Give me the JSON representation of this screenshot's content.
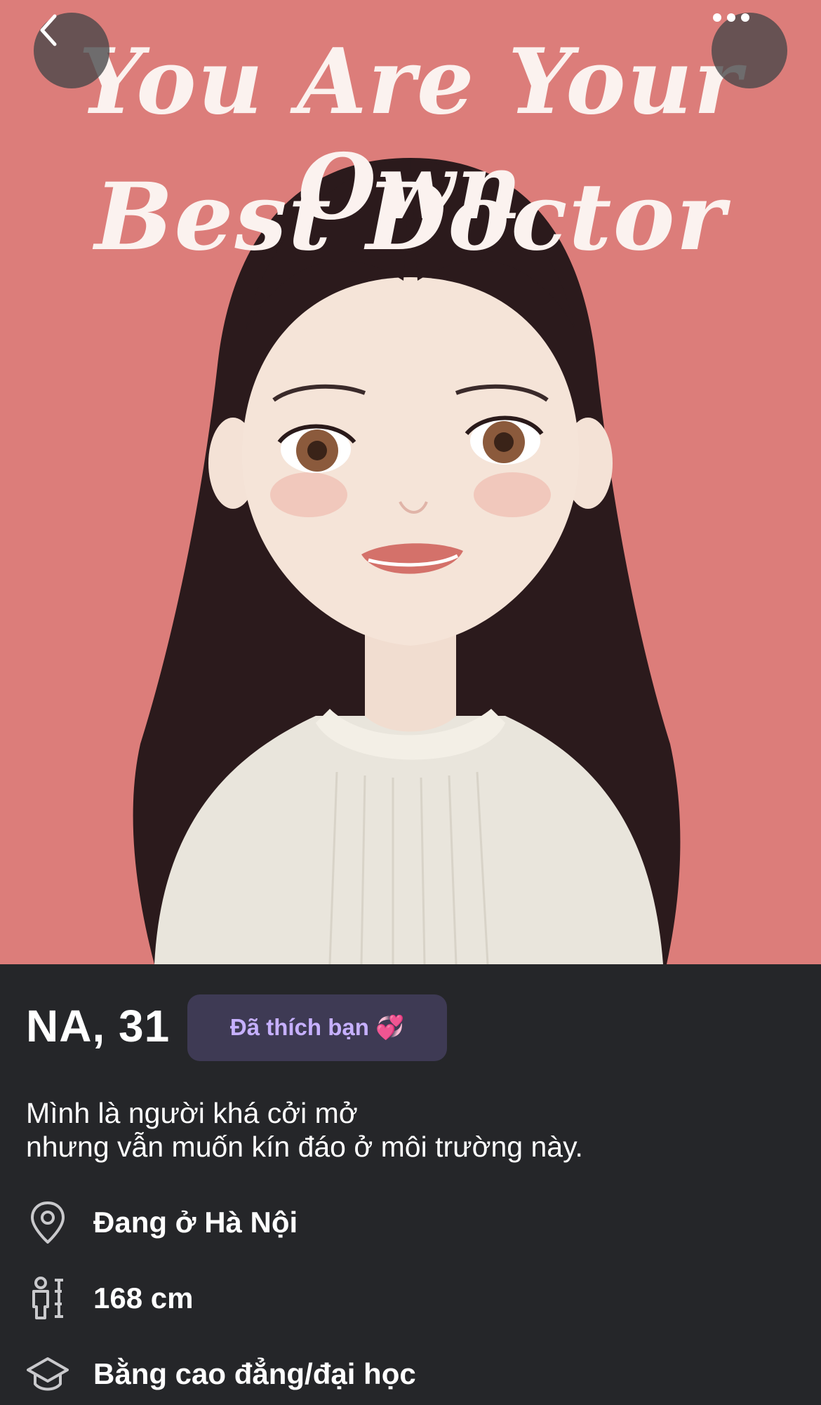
{
  "photo": {
    "title_line1": "You Are Your Own",
    "title_line2": "Best Doctor",
    "background_color": "#dc7d7a"
  },
  "nav": {
    "back_icon": "chevron-left-icon",
    "more_icon": "ellipsis-icon"
  },
  "profile": {
    "name_age": "NA, 31",
    "liked_badge": "Đã thích bạn 💞",
    "bio_line1": "Mình là người khá cởi mở",
    "bio_line2": "nhưng vẫn muốn kín đáo ở môi trường này.",
    "details": [
      {
        "icon": "location-pin-icon",
        "text": "Đang ở Hà Nội"
      },
      {
        "icon": "height-icon",
        "text": "168 cm"
      },
      {
        "icon": "graduation-cap-icon",
        "text": "Bằng cao đẳng/đại học"
      }
    ]
  },
  "colors": {
    "badge_bg": "#3e3a54",
    "badge_text": "#c6b0ff",
    "panel_bg": "#252629"
  }
}
